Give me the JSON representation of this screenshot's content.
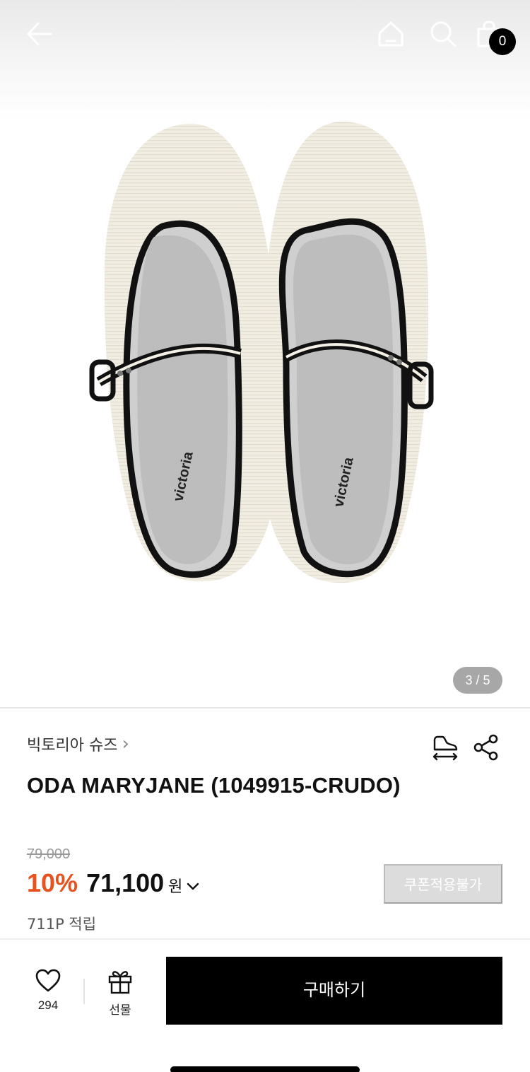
{
  "header": {
    "back_icon": "arrow-left-icon",
    "home_icon": "home-icon",
    "search_icon": "search-icon",
    "cart_icon": "shopping-bag-icon",
    "cart_count": "0"
  },
  "gallery": {
    "image_alt": "ODA MARYJANE cream canvas shoes",
    "page_indicator": "3 / 5"
  },
  "product": {
    "brand": "빅토리아 슈즈",
    "brand_chevron": "›",
    "title": "ODA MARYJANE (1049915-CRUDO)",
    "size_icon": "shoe-size-icon",
    "share_icon": "share-icon"
  },
  "pricing": {
    "original_price": "79,000",
    "discount": "10%",
    "sale_price": "71,100",
    "currency": "원",
    "coupon_button": "쿠폰적용불가",
    "points": "711P 적립"
  },
  "bottom_bar": {
    "like_count": "294",
    "gift_label": "선물",
    "buy_label": "구매하기"
  },
  "colors": {
    "accent": "#e8521f",
    "buy_button": "#000000",
    "coupon_disabled": "#dcdcdc"
  }
}
